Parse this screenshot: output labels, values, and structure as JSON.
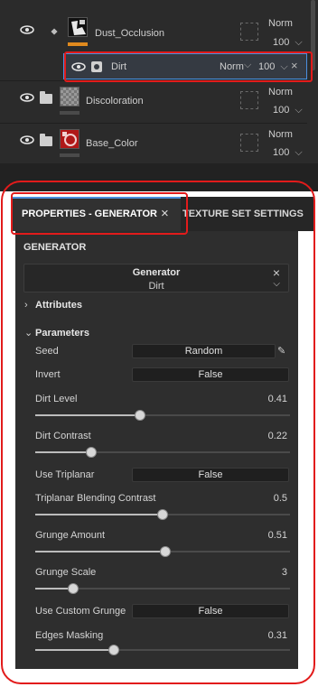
{
  "layers": [
    {
      "name": "Dust_Occlusion",
      "blend": "Norm",
      "opacity": "100",
      "thumb_color": "#111111",
      "bar_color": "#e08a1e"
    },
    {
      "name": "Dirt",
      "blend": "Norm",
      "opacity": "100",
      "selected": true
    },
    {
      "name": "Discoloration",
      "blend": "Norm",
      "opacity": "100",
      "thumb_color": "#7a7a7a"
    },
    {
      "name": "Base_Color",
      "blend": "Norm",
      "opacity": "100",
      "thumb_color": "#b01818"
    }
  ],
  "tabs": {
    "properties": "PROPERTIES - GENERATOR",
    "texture_set": "TEXTURE SET SETTINGS"
  },
  "panel": {
    "title": "GENERATOR",
    "generator_label": "Generator",
    "generator_value": "Dirt",
    "attributes": "Attributes",
    "parameters": "Parameters"
  },
  "params": {
    "seed": {
      "label": "Seed",
      "value": "Random"
    },
    "invert": {
      "label": "Invert",
      "value": "False"
    },
    "dirt_level": {
      "label": "Dirt Level",
      "value": "0.41",
      "fraction": 0.41
    },
    "dirt_contrast": {
      "label": "Dirt Contrast",
      "value": "0.22",
      "fraction": 0.22
    },
    "use_triplanar": {
      "label": "Use Triplanar",
      "value": "False"
    },
    "triplanar_blend": {
      "label": "Triplanar Blending Contrast",
      "value": "0.5",
      "fraction": 0.5
    },
    "grunge_amount": {
      "label": "Grunge Amount",
      "value": "0.51",
      "fraction": 0.51
    },
    "grunge_scale": {
      "label": "Grunge Scale",
      "value": "3",
      "fraction": 0.15
    },
    "use_custom_grunge": {
      "label": "Use Custom Grunge",
      "value": "False"
    },
    "edges_masking": {
      "label": "Edges Masking",
      "value": "0.31",
      "fraction": 0.31
    }
  },
  "colors": {
    "accent": "#4b8fdf",
    "annotation": "#e21b1b"
  }
}
